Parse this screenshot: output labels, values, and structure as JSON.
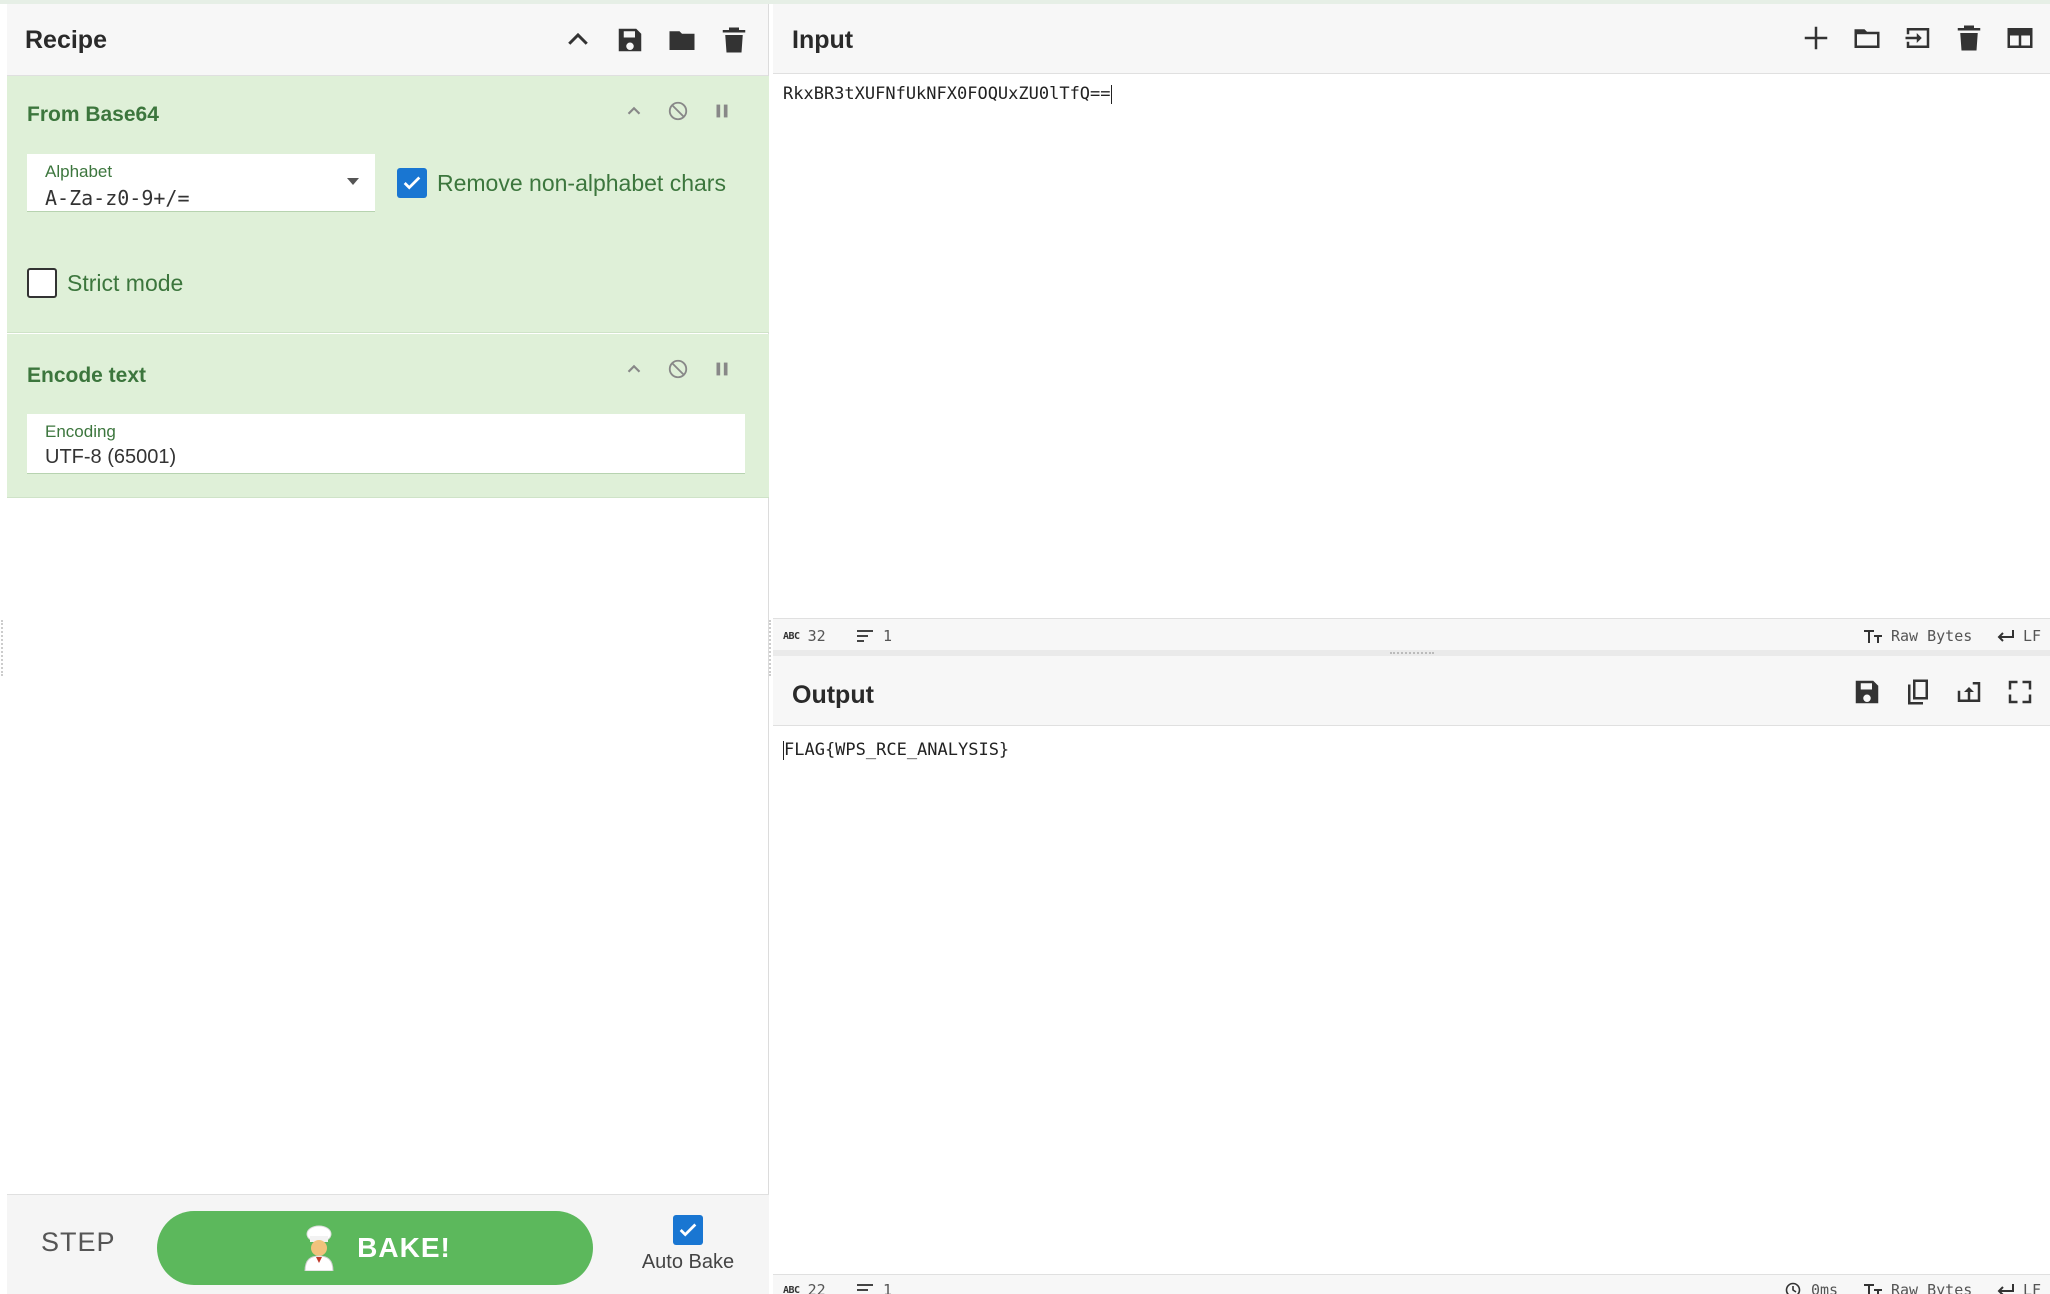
{
  "recipe": {
    "title": "Recipe",
    "operations": [
      {
        "name": "From Base64",
        "alphabet_label": "Alphabet",
        "alphabet_value": "A-Za-z0-9+/=",
        "remove_non_alphabet_label": "Remove non-alphabet chars",
        "remove_non_alphabet_checked": true,
        "strict_mode_label": "Strict mode",
        "strict_mode_checked": false
      },
      {
        "name": "Encode text",
        "encoding_label": "Encoding",
        "encoding_value": "UTF-8 (65001)"
      }
    ],
    "step_label": "STEP",
    "bake_label": "BAKE!",
    "autobake_label": "Auto Bake",
    "autobake_checked": true
  },
  "input": {
    "title": "Input",
    "text": "RkxBR3tXUFNfUkNFX0FOQUxZU0lTfQ==",
    "status": {
      "chars": "32",
      "lines": "1",
      "format": "Raw Bytes",
      "eol": "LF"
    }
  },
  "output": {
    "title": "Output",
    "text": "FLAG{WPS_RCE_ANALYSIS}",
    "status": {
      "chars": "22",
      "lines": "1",
      "time": "0ms",
      "format": "Raw Bytes",
      "eol": "LF"
    }
  },
  "colors": {
    "operation_bg": "#dff0d8",
    "operation_text": "#3c763d",
    "bake_button": "#5cb85c",
    "checkbox_on": "#1976d2"
  },
  "icons": {
    "recipe_header": [
      "chevron-up-icon",
      "save-icon",
      "folder-icon",
      "trash-icon"
    ],
    "input_header": [
      "plus-icon",
      "folder-icon",
      "import-icon",
      "trash-icon",
      "layout-icon"
    ],
    "output_header": [
      "save-icon",
      "copy-icon",
      "replace-input-icon",
      "maximize-icon"
    ],
    "operation_controls": [
      "chevron-up-icon",
      "disable-icon",
      "pause-icon"
    ]
  }
}
